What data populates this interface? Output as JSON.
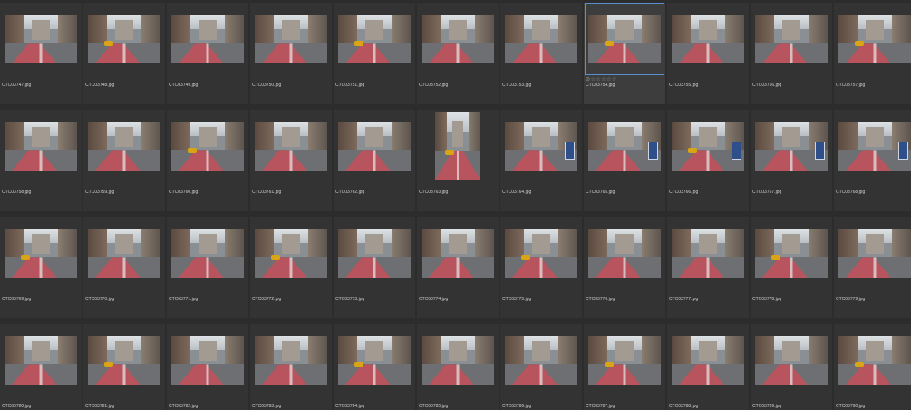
{
  "grid": {
    "rows": [
      {
        "items": [
          {
            "filename": "CTC03747.jpg"
          },
          {
            "filename": "CTC03748.jpg"
          },
          {
            "filename": "CTC03749.jpg"
          },
          {
            "filename": "CTC03750.jpg"
          },
          {
            "filename": "CTC03751.jpg"
          },
          {
            "filename": "CTC03752.jpg"
          },
          {
            "filename": "CTC03753.jpg"
          },
          {
            "filename": "CTC03754.jpg",
            "selected": true,
            "rating_display": "⊘☆☆☆☆☆"
          },
          {
            "filename": "CTC03755.jpg"
          },
          {
            "filename": "CTC03756.jpg"
          },
          {
            "filename": "CTC03757.jpg"
          }
        ]
      },
      {
        "items": [
          {
            "filename": "CTC03758.jpg"
          },
          {
            "filename": "CTC03759.jpg"
          },
          {
            "filename": "CTC03760.jpg"
          },
          {
            "filename": "CTC03761.jpg"
          },
          {
            "filename": "CTC03762.jpg"
          },
          {
            "filename": "CTC03763.jpg",
            "orientation": "portrait"
          },
          {
            "filename": "CTC03764.jpg"
          },
          {
            "filename": "CTC03765.jpg"
          },
          {
            "filename": "CTC03766.jpg"
          },
          {
            "filename": "CTC03767.jpg"
          },
          {
            "filename": "CTC03768.jpg"
          }
        ]
      },
      {
        "items": [
          {
            "filename": "CTC03769.jpg"
          },
          {
            "filename": "CTC03770.jpg"
          },
          {
            "filename": "CTC03771.jpg"
          },
          {
            "filename": "CTC03772.jpg"
          },
          {
            "filename": "CTC03773.jpg"
          },
          {
            "filename": "CTC03774.jpg"
          },
          {
            "filename": "CTC03775.jpg"
          },
          {
            "filename": "CTC03776.jpg"
          },
          {
            "filename": "CTC03777.jpg"
          },
          {
            "filename": "CTC03778.jpg"
          },
          {
            "filename": "CTC03779.jpg"
          }
        ]
      },
      {
        "items": [
          {
            "filename": "CTC03780.jpg"
          },
          {
            "filename": "CTC03781.jpg"
          },
          {
            "filename": "CTC03782.jpg"
          },
          {
            "filename": "CTC03783.jpg"
          },
          {
            "filename": "CTC03784.jpg"
          },
          {
            "filename": "CTC03785.jpg"
          },
          {
            "filename": "CTC03786.jpg"
          },
          {
            "filename": "CTC03787.jpg"
          },
          {
            "filename": "CTC03788.jpg"
          },
          {
            "filename": "CTC03789.jpg"
          },
          {
            "filename": "CTC03790.jpg"
          }
        ]
      }
    ]
  },
  "colors": {
    "background": "#2c2c2c",
    "cell": "#333333",
    "selection_border": "#5a8fd0",
    "bus_lane": "#b8545e",
    "filename_text": "#d0d0d0"
  }
}
